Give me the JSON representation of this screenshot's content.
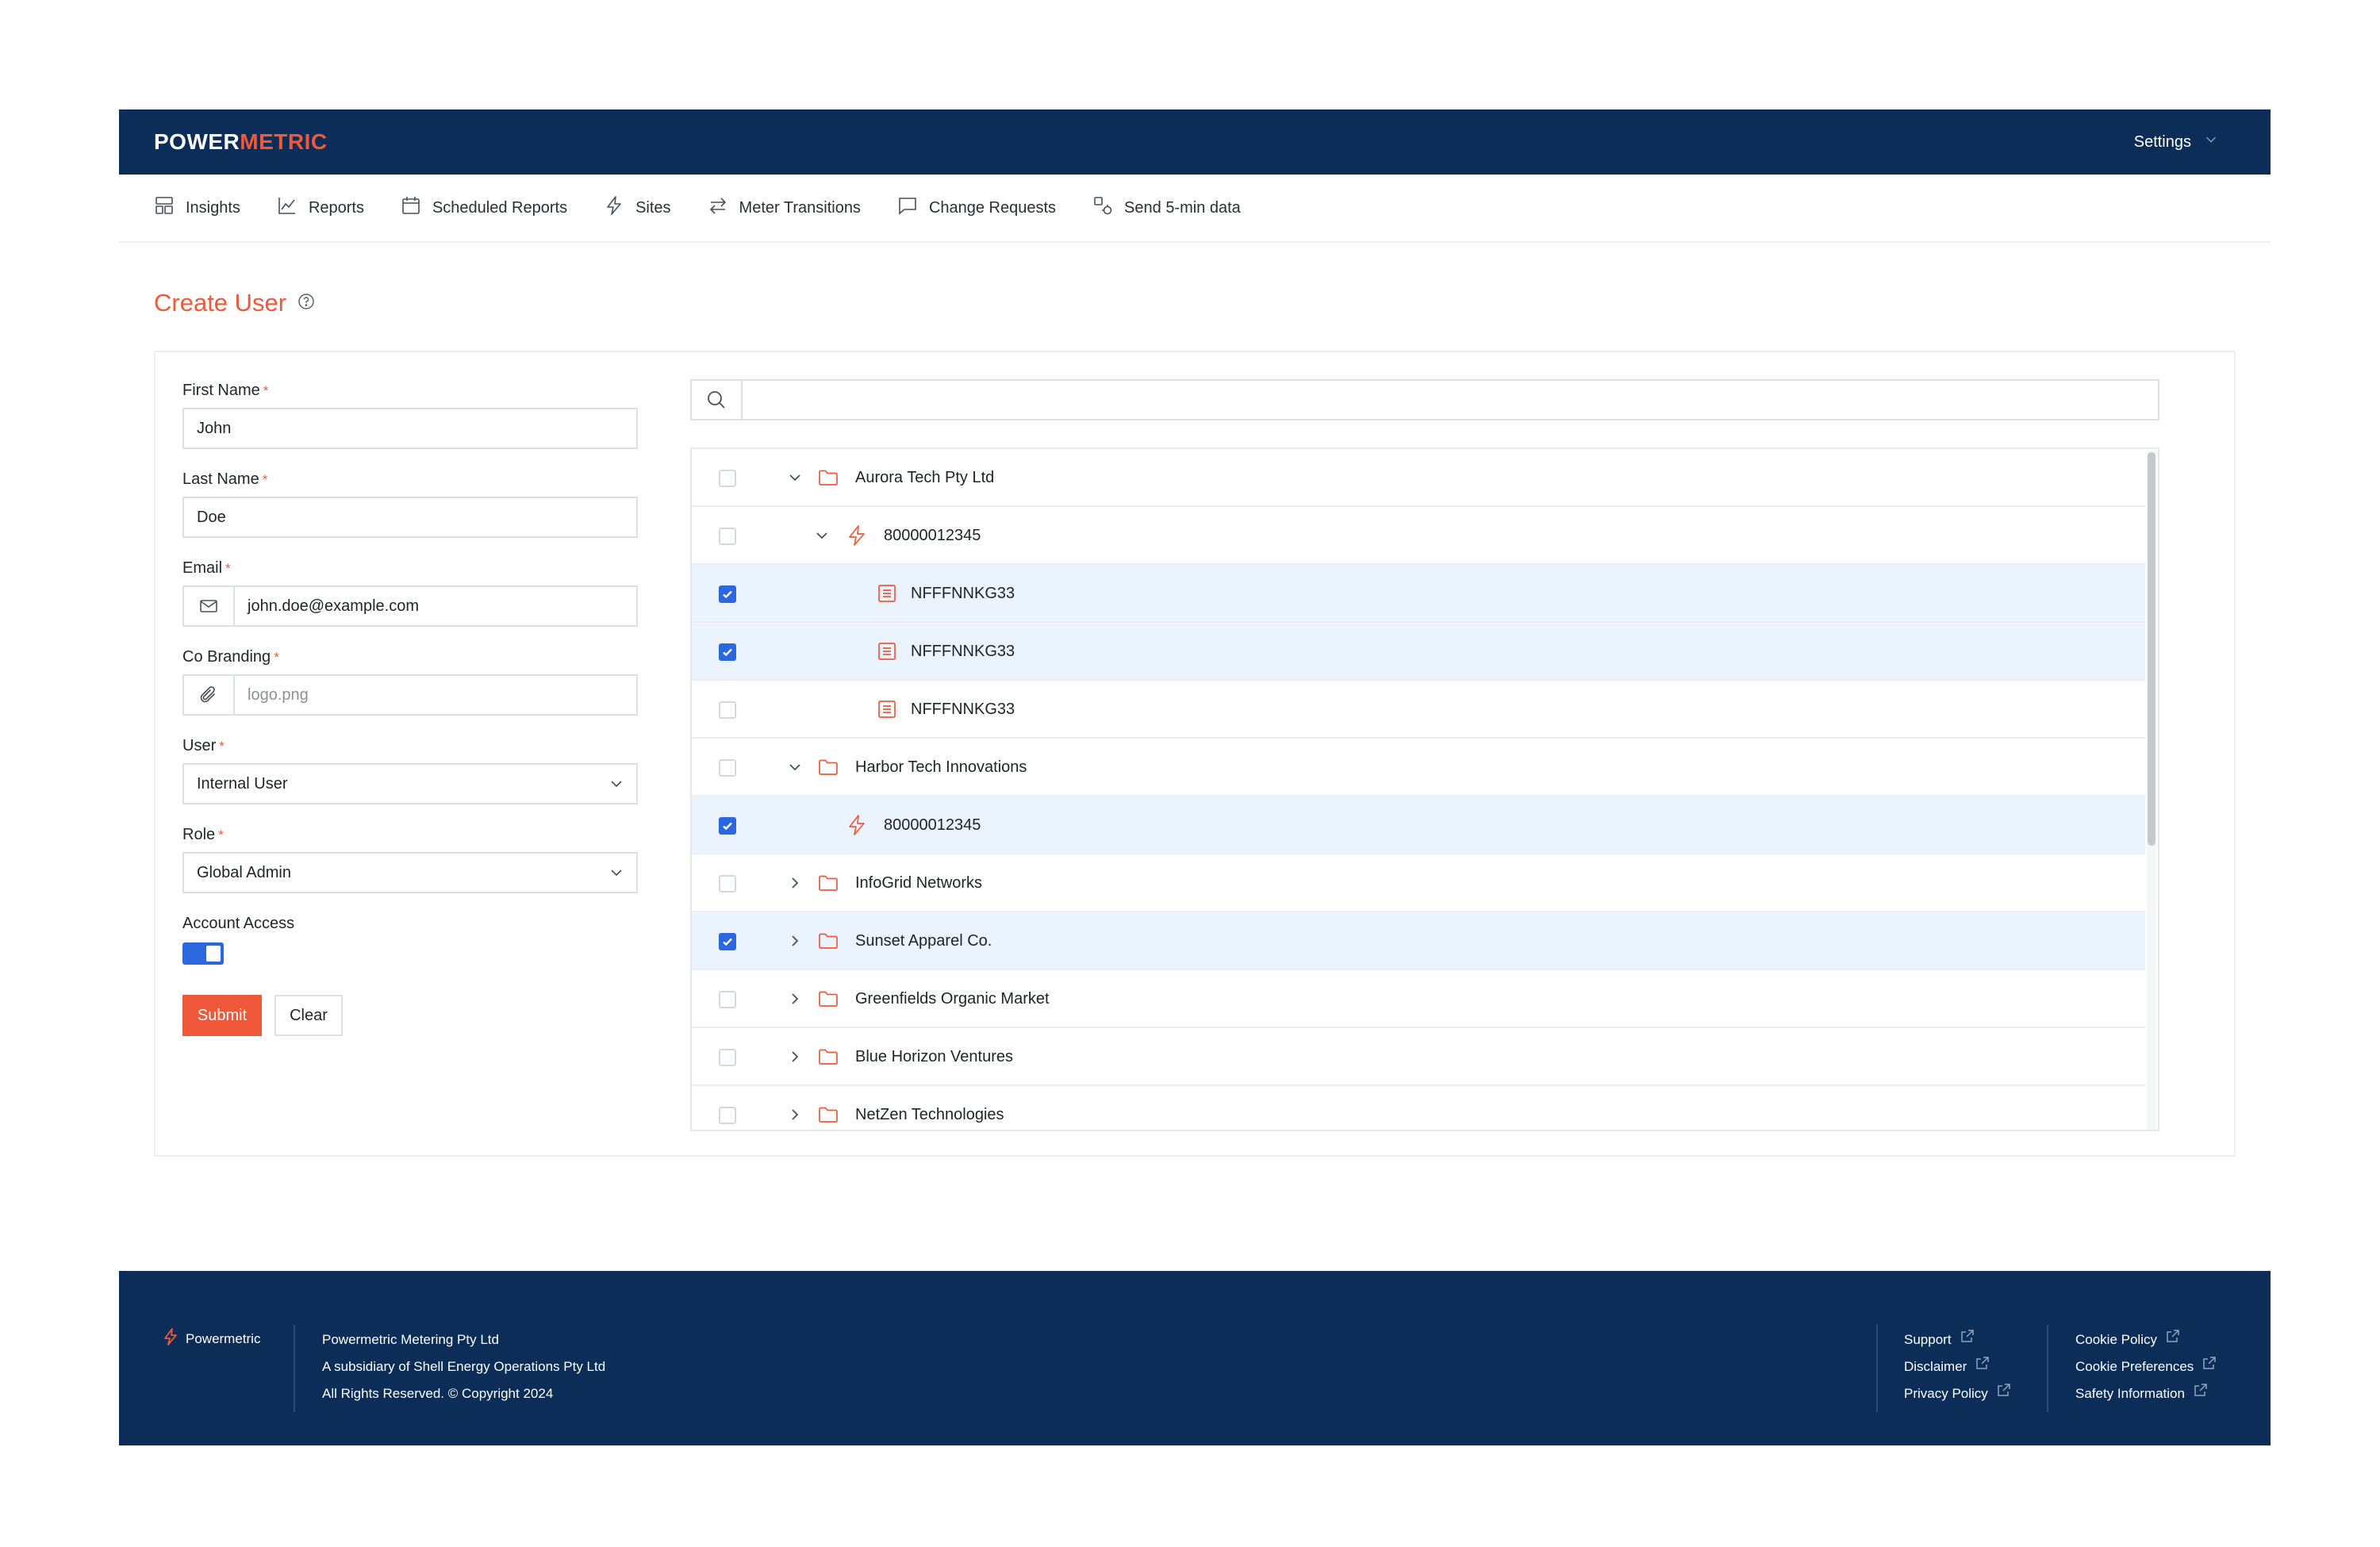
{
  "brand": {
    "logo_prefix": "POWER",
    "logo_accent": "METRIC",
    "accent_color": "#f0583a",
    "header_bg": "#0b2d57"
  },
  "header": {
    "settings_label": "Settings"
  },
  "nav": {
    "items": [
      {
        "label": "Insights",
        "icon": "dashboard-icon"
      },
      {
        "label": "Reports",
        "icon": "line-chart-icon"
      },
      {
        "label": "Scheduled Reports",
        "icon": "calendar-icon"
      },
      {
        "label": "Sites",
        "icon": "bolt-icon"
      },
      {
        "label": "Meter Transitions",
        "icon": "swap-icon"
      },
      {
        "label": "Change Requests",
        "icon": "message-icon"
      },
      {
        "label": "Send 5-min data",
        "icon": "shapes-icon"
      }
    ]
  },
  "page": {
    "title": "Create User"
  },
  "form": {
    "first_name": {
      "label": "First Name",
      "required": "*",
      "value": "John"
    },
    "last_name": {
      "label": "Last Name",
      "required": "*",
      "value": "Doe"
    },
    "email": {
      "label": "Email",
      "required": "*",
      "value": "john.doe@example.com"
    },
    "co_branding": {
      "label": "Co Branding",
      "required": "*",
      "placeholder": "logo.png"
    },
    "user": {
      "label": "User",
      "required": "*",
      "value": "Internal User"
    },
    "role": {
      "label": "Role",
      "required": "*",
      "value": "Global Admin"
    },
    "account_access": {
      "label": "Account Access",
      "enabled": true
    },
    "submit_label": "Submit",
    "clear_label": "Clear"
  },
  "search": {
    "value": ""
  },
  "tree": {
    "rows": [
      {
        "label": "Aurora Tech Pty Ltd",
        "type": "folder",
        "level": 0,
        "expander": "expanded",
        "checked": false
      },
      {
        "label": "80000012345",
        "type": "site",
        "level": 1,
        "expander": "expanded",
        "checked": false
      },
      {
        "label": "NFFFNNKG33",
        "type": "meter",
        "level": 2,
        "expander": "none",
        "checked": true
      },
      {
        "label": "NFFFNNKG33",
        "type": "meter",
        "level": 2,
        "expander": "none",
        "checked": true
      },
      {
        "label": "NFFFNNKG33",
        "type": "meter",
        "level": 2,
        "expander": "none",
        "checked": false
      },
      {
        "label": "Harbor Tech Innovations",
        "type": "folder",
        "level": 0,
        "expander": "expanded",
        "checked": false
      },
      {
        "label": "80000012345",
        "type": "site",
        "level": 1,
        "expander": "none",
        "checked": true
      },
      {
        "label": "InfoGrid Networks",
        "type": "folder",
        "level": 0,
        "expander": "collapsed",
        "checked": false
      },
      {
        "label": "Sunset Apparel Co.",
        "type": "folder",
        "level": 0,
        "expander": "collapsed",
        "checked": true
      },
      {
        "label": "Greenfields Organic Market",
        "type": "folder",
        "level": 0,
        "expander": "collapsed",
        "checked": false
      },
      {
        "label": "Blue Horizon Ventures",
        "type": "folder",
        "level": 0,
        "expander": "collapsed",
        "checked": false
      },
      {
        "label": "NetZen Technologies",
        "type": "folder",
        "level": 0,
        "expander": "collapsed",
        "checked": false
      }
    ]
  },
  "footer": {
    "brand_name": "Powermetric",
    "company_lines": [
      "Powermetric Metering Pty Ltd",
      "A subsidiary of Shell Energy Operations Pty Ltd",
      "All Rights Reserved. © Copyright 2024"
    ],
    "links_col1": [
      "Support",
      "Disclaimer",
      "Privacy Policy"
    ],
    "links_col2": [
      "Cookie Policy",
      "Cookie Preferences",
      "Safety Information"
    ]
  }
}
